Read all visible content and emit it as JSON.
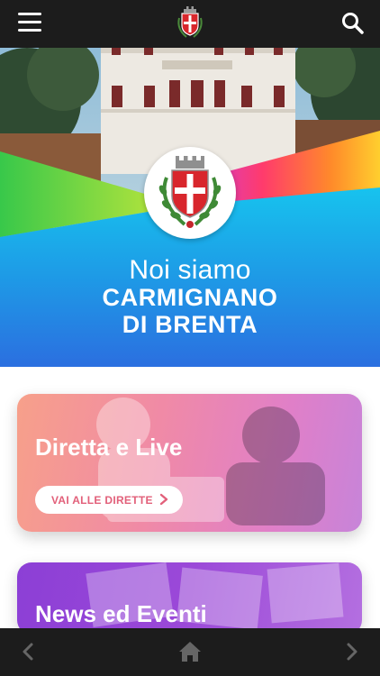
{
  "hero": {
    "tagline": "Noi siamo",
    "city_line1": "CARMIGNANO",
    "city_line2": "DI BRENTA"
  },
  "cards": [
    {
      "title": "Diretta e Live",
      "button": "VAI ALLE DIRETTE"
    },
    {
      "title": "News ed Eventi"
    }
  ],
  "icons": {
    "menu": "hamburger-menu-icon",
    "logo": "municipal-coat-of-arms",
    "search": "search-icon",
    "back": "chevron-left-icon",
    "home": "home-icon",
    "forward": "chevron-right-icon"
  },
  "colors": {
    "bar": "#1c1c1c",
    "button_text": "#e2607a",
    "hero_blue": "#1fb2e8"
  }
}
